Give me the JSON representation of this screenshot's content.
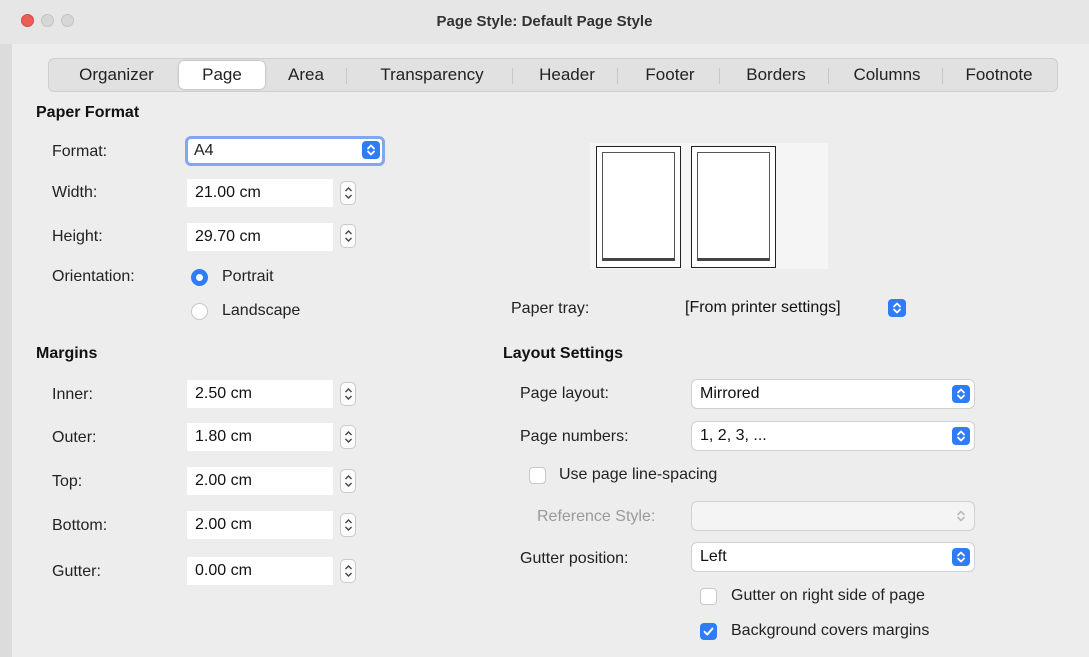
{
  "window": {
    "title": "Page Style: Default Page Style"
  },
  "tabs": [
    "Organizer",
    "Page",
    "Area",
    "Transparency",
    "Header",
    "Footer",
    "Borders",
    "Columns",
    "Footnote"
  ],
  "paper_format": {
    "heading": "Paper Format",
    "format_label": "Format:",
    "format_value": "A4",
    "width_label": "Width:",
    "width_value": "21.00 cm",
    "height_label": "Height:",
    "height_value": "29.70 cm",
    "orientation_label": "Orientation:",
    "portrait_label": "Portrait",
    "landscape_label": "Landscape",
    "orientation_selected": "Portrait"
  },
  "paper_tray": {
    "label": "Paper tray:",
    "value": "[From printer settings]"
  },
  "margins": {
    "heading": "Margins",
    "inner_label": "Inner:",
    "inner_value": "2.50 cm",
    "outer_label": "Outer:",
    "outer_value": "1.80 cm",
    "top_label": "Top:",
    "top_value": "2.00 cm",
    "bottom_label": "Bottom:",
    "bottom_value": "2.00 cm",
    "gutter_label": "Gutter:",
    "gutter_value": "0.00 cm"
  },
  "layout_settings": {
    "heading": "Layout Settings",
    "page_layout_label": "Page layout:",
    "page_layout_value": "Mirrored",
    "page_numbers_label": "Page numbers:",
    "page_numbers_value": "1, 2, 3, ...",
    "use_line_spacing_label": "Use page line-spacing",
    "use_line_spacing_checked": false,
    "reference_style_label": "Reference Style:",
    "reference_style_value": "",
    "gutter_position_label": "Gutter position:",
    "gutter_position_value": "Left",
    "gutter_right_label": "Gutter on right side of page",
    "gutter_right_checked": false,
    "bg_covers_label": "Background covers margins",
    "bg_covers_checked": true
  },
  "colors": {
    "accent": "#2f7cf6",
    "close": "#ec5f57"
  }
}
